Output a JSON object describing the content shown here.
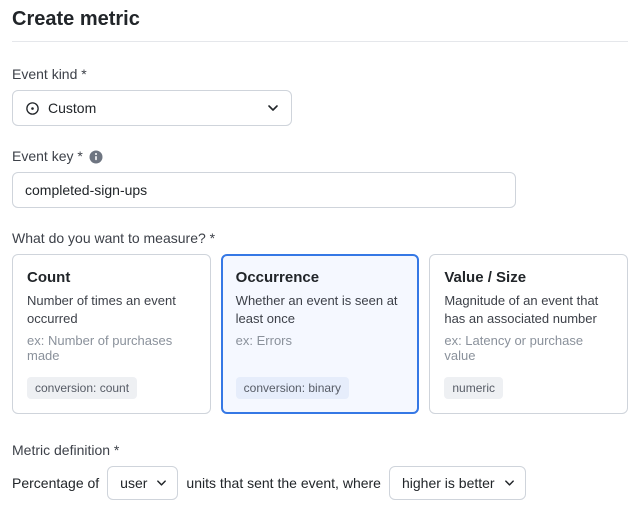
{
  "page_title": "Create metric",
  "event_kind": {
    "label": "Event kind *",
    "value": "Custom"
  },
  "event_key": {
    "label": "Event key *",
    "value": "completed-sign-ups"
  },
  "measure": {
    "label": "What do you want to measure? *",
    "selected": "occurrence",
    "options": {
      "count": {
        "title": "Count",
        "desc": "Number of times an event occurred",
        "example": "ex: Number of purchases made",
        "tag": "conversion: count"
      },
      "occurrence": {
        "title": "Occurrence",
        "desc": "Whether an event is seen at least once",
        "example": "ex: Errors",
        "tag": "conversion: binary"
      },
      "value": {
        "title": "Value / Size",
        "desc": "Magnitude of an event that has an associated number",
        "example": "ex: Latency or purchase value",
        "tag": "numeric"
      }
    }
  },
  "definition": {
    "label": "Metric definition *",
    "prefix": "Percentage of",
    "unit": "user",
    "middle": "units that sent the event, where",
    "direction": "higher is better"
  }
}
